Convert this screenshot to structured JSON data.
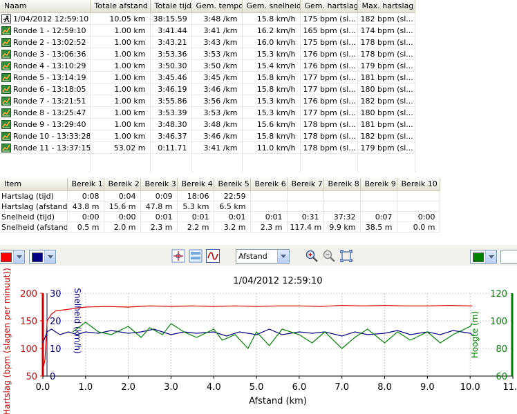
{
  "laps": {
    "columns": [
      "Naam",
      "Totale afstand",
      "Totale tijd",
      "Gem. tempo",
      "Gem. snelheid",
      "Gem. hartslag",
      "Max. hartslag"
    ],
    "rows": [
      {
        "name": "1/04/2012 12:59:10",
        "icon": "runner-icon",
        "dist": "10.05 km",
        "time": "38:15.59",
        "pace": "3:48 /km",
        "speed": "15.8 km/h",
        "avg_hr": "175 bpm (sl...",
        "max_hr": "182 bpm (sl..."
      },
      {
        "name": "Ronde 1 - 12:59:10",
        "icon": "lap-icon",
        "dist": "1.00 km",
        "time": "3:41.44",
        "pace": "3:41 /km",
        "speed": "16.2 km/h",
        "avg_hr": "165 bpm (sl...",
        "max_hr": "174 bpm (sl..."
      },
      {
        "name": "Ronde 2 - 13:02:52",
        "icon": "lap-icon",
        "dist": "1.00 km",
        "time": "3:43.21",
        "pace": "3:43 /km",
        "speed": "16.0 km/h",
        "avg_hr": "175 bpm (sl...",
        "max_hr": "178 bpm (sl..."
      },
      {
        "name": "Ronde 3 - 13:06:36",
        "icon": "lap-icon",
        "dist": "1.00 km",
        "time": "3:53.36",
        "pace": "3:53 /km",
        "speed": "15.3 km/h",
        "avg_hr": "176 bpm (sl...",
        "max_hr": "178 bpm (sl..."
      },
      {
        "name": "Ronde 4 - 13:10:29",
        "icon": "lap-icon",
        "dist": "1.00 km",
        "time": "3:50.30",
        "pace": "3:50 /km",
        "speed": "15.4 km/h",
        "avg_hr": "176 bpm (sl...",
        "max_hr": "179 bpm (sl..."
      },
      {
        "name": "Ronde 5 - 13:14:19",
        "icon": "lap-icon",
        "dist": "1.00 km",
        "time": "3:45.46",
        "pace": "3:45 /km",
        "speed": "15.8 km/h",
        "avg_hr": "177 bpm (sl...",
        "max_hr": "181 bpm (sl..."
      },
      {
        "name": "Ronde 6 - 13:18:05",
        "icon": "lap-icon",
        "dist": "1.00 km",
        "time": "3:46.19",
        "pace": "3:46 /km",
        "speed": "15.8 km/h",
        "avg_hr": "177 bpm (sl...",
        "max_hr": "180 bpm (sl..."
      },
      {
        "name": "Ronde 7 - 13:21:51",
        "icon": "lap-icon",
        "dist": "1.00 km",
        "time": "3:55.86",
        "pace": "3:56 /km",
        "speed": "15.3 km/h",
        "avg_hr": "176 bpm (sl...",
        "max_hr": "182 bpm (sl..."
      },
      {
        "name": "Ronde 8 - 13:25:47",
        "icon": "lap-icon",
        "dist": "1.00 km",
        "time": "3:53.39",
        "pace": "3:53 /km",
        "speed": "15.3 km/h",
        "avg_hr": "177 bpm (sl...",
        "max_hr": "180 bpm (sl..."
      },
      {
        "name": "Ronde 9 - 13:29:40",
        "icon": "lap-icon",
        "dist": "1.00 km",
        "time": "3:48.30",
        "pace": "3:48 /km",
        "speed": "15.6 km/h",
        "avg_hr": "178 bpm (sl...",
        "max_hr": "181 bpm (sl..."
      },
      {
        "name": "Ronde 10 - 13:33:28",
        "icon": "lap-icon",
        "dist": "1.00 km",
        "time": "3:46.37",
        "pace": "3:46 /km",
        "speed": "15.8 km/h",
        "avg_hr": "178 bpm (sl...",
        "max_hr": "182 bpm (sl..."
      },
      {
        "name": "Ronde 11 - 13:37:15",
        "icon": "lap-icon",
        "dist": "53.02 m",
        "time": "0:11.71",
        "pace": "3:41 /km",
        "speed": "11.0 km/h",
        "avg_hr": "178 bpm (sl...",
        "max_hr": "179 bpm (sl..."
      }
    ]
  },
  "zones": {
    "columns": [
      "Item",
      "Bereik 1",
      "Bereik 2",
      "Bereik 3",
      "Bereik 4",
      "Bereik 5",
      "Bereik 6",
      "Bereik 7",
      "Bereik 8",
      "Bereik 9",
      "Bereik 10"
    ],
    "rows": [
      {
        "item": "Hartslag (tijd)",
        "values": [
          "0:08",
          "0:04",
          "0:09",
          "18:06",
          "22:59",
          "",
          "",
          "",
          "",
          ""
        ]
      },
      {
        "item": "Hartslag (afstand)",
        "values": [
          "43.8 m",
          "15.6 m",
          "47.8 m",
          "5.3 km",
          "6.5 km",
          "",
          "",
          "",
          "",
          ""
        ]
      },
      {
        "item": "Snelheid (tijd)",
        "values": [
          "0:00",
          "0:00",
          "0:01",
          "0:01",
          "0:01",
          "0:01",
          "0:31",
          "37:32",
          "0:07",
          "0:00"
        ]
      },
      {
        "item": "Snelheid (afstand)",
        "values": [
          "0.5 m",
          "2.0 m",
          "2.3 m",
          "2.2 m",
          "3.2 m",
          "2.3 m",
          "117.4 m",
          "9.9 km",
          "38.5 m",
          "0.0 m"
        ]
      }
    ]
  },
  "toolbar": {
    "color1": "#ff0000",
    "color2": "#000080",
    "color3": "#008000",
    "xaxis_select": "Afstand",
    "icons": [
      "crosshair-icon",
      "panel-icon",
      "curve-icon",
      "zoom-in-icon",
      "zoom-out-icon",
      "fit-icon"
    ]
  },
  "chart_data": {
    "type": "line",
    "title": "1/04/2012 12:59:10",
    "xlabel": "Afstand (km)",
    "xlim": [
      0,
      11
    ],
    "xticks": [
      "0.0",
      "1.0",
      "2.0",
      "3.0",
      "4.0",
      "5.0",
      "6.0",
      "7.0",
      "8.0",
      "9.0",
      "10.0",
      "11.0"
    ],
    "grid": true,
    "axes": {
      "heart_rate": {
        "label": "Hartslag (bpm (slagen per minuut))",
        "range": [
          50,
          200
        ],
        "ticks": [
          "50",
          "100",
          "150",
          "200"
        ],
        "color": "#cc0000"
      },
      "speed": {
        "label": "Snelheid (km/h)",
        "range": [
          0,
          30
        ],
        "ticks": [
          "0",
          "10",
          "20",
          "30"
        ],
        "color": "#000080"
      },
      "altitude": {
        "label": "Hoogte (m)",
        "range": [
          60,
          120
        ],
        "ticks": [
          "60",
          "80",
          "100",
          "120"
        ],
        "color": "#008000"
      }
    },
    "series": [
      {
        "axis": "heart_rate",
        "color": "#dd0000",
        "x": [
          0,
          0.05,
          0.1,
          0.2,
          0.3,
          0.5,
          0.7,
          1.0,
          1.5,
          2.0,
          2.5,
          3.0,
          3.5,
          4.0,
          4.5,
          5.0,
          5.5,
          6.0,
          6.5,
          7.0,
          7.5,
          8.0,
          8.5,
          9.0,
          9.5,
          10.0,
          10.05
        ],
        "values": [
          60,
          80,
          150,
          162,
          168,
          170,
          172,
          175,
          176,
          175,
          177,
          176,
          177,
          176,
          177,
          176,
          177,
          177,
          176,
          178,
          177,
          178,
          177,
          177,
          178,
          177,
          177
        ]
      },
      {
        "axis": "speed",
        "color": "#000080",
        "x": [
          0,
          0.1,
          0.2,
          0.4,
          0.6,
          0.8,
          1.0,
          1.3,
          1.6,
          2.0,
          2.3,
          2.6,
          3.0,
          3.3,
          3.6,
          4.0,
          4.3,
          4.6,
          5.0,
          5.3,
          5.6,
          6.0,
          6.3,
          6.6,
          7.0,
          7.3,
          7.6,
          8.0,
          8.3,
          8.6,
          9.0,
          9.3,
          9.6,
          10.0,
          10.05
        ],
        "values": [
          12,
          16,
          17,
          15,
          16,
          15,
          16,
          15.5,
          16.5,
          15.5,
          16,
          17,
          15,
          16,
          15.5,
          16,
          14.5,
          16,
          15,
          17,
          15,
          16,
          15.5,
          16,
          14.5,
          16,
          15,
          15.5,
          16.5,
          15,
          16,
          15,
          16.5,
          15.5,
          15
        ]
      },
      {
        "axis": "altitude",
        "color": "#008000",
        "x": [
          0.7,
          1.0,
          1.3,
          1.6,
          2.0,
          2.3,
          2.5,
          2.8,
          3.0,
          3.3,
          3.6,
          4.0,
          4.2,
          4.5,
          4.8,
          5.0,
          5.3,
          5.6,
          6.0,
          6.3,
          6.6,
          7.0,
          7.3,
          7.6,
          8.0,
          8.3,
          8.6,
          9.0,
          9.3,
          9.6,
          10.0,
          10.05
        ],
        "values": [
          92,
          99,
          92,
          90,
          96,
          88,
          95,
          90,
          98,
          92,
          88,
          94,
          86,
          90,
          80,
          92,
          82,
          94,
          90,
          84,
          92,
          80,
          88,
          94,
          84,
          92,
          86,
          92,
          84,
          90,
          96,
          98
        ]
      }
    ]
  }
}
